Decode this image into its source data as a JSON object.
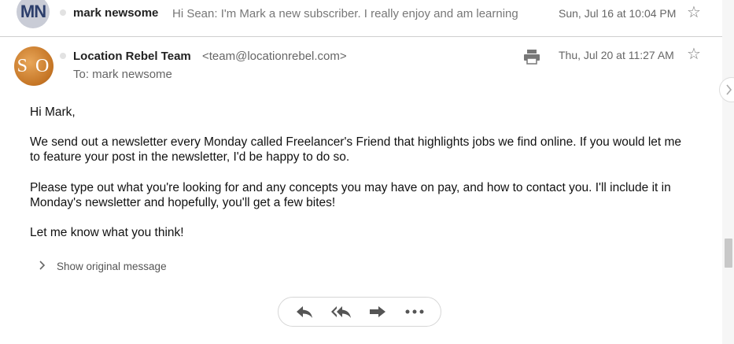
{
  "thread": {
    "collapsed_message": {
      "avatar_initials": "MN",
      "sender": "mark newsome",
      "snippet": "Hi Sean: I'm Mark a new subscriber. I really enjoy and am learning",
      "date": "Sun, Jul 16 at 10:04 PM"
    },
    "open_message": {
      "avatar_initials": "S O",
      "sender_name": "Location Rebel Team",
      "sender_email": "<team@locationrebel.com>",
      "to_line": "To: mark newsome",
      "date": "Thu, Jul 20 at 11:27 AM",
      "body": {
        "greeting": "Hi Mark,",
        "para1": "We send out a newsletter every Monday called Freelancer's Friend that highlights jobs we find online. If you would let me to feature your post in the newsletter, I'd be happy to do so.",
        "para2": "Please type out what you're looking for and any concepts you may have on pay, and how to contact you. I'll include it in Monday's newsletter and hopefully, you'll get a few bites!",
        "para3": "Let me know what you think!"
      },
      "show_original_label": "Show original message"
    }
  },
  "icons": {
    "star": "star-icon",
    "print": "print-icon",
    "reply": "reply-icon",
    "reply_all": "reply-all-icon",
    "forward": "forward-icon",
    "more": "more-icon"
  },
  "colors": {
    "text": "#222222",
    "muted": "#666666",
    "avatar_mn_bg": "#c9ccd6",
    "avatar_so_bg": "#c47424"
  }
}
